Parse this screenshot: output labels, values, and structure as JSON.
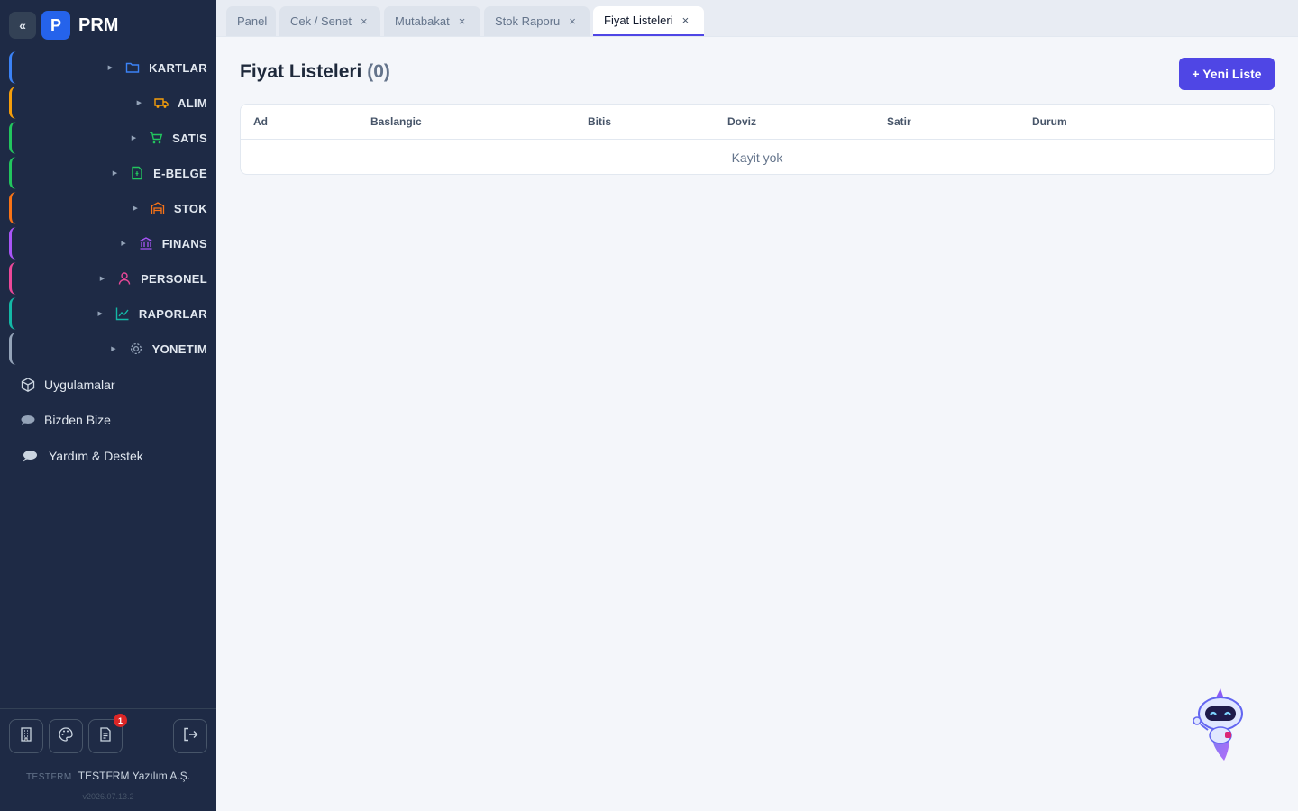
{
  "app": {
    "name": "PRM",
    "logo_letter": "P",
    "collapse_glyph": "«",
    "accent_color": "#4f46e5"
  },
  "sidebar": {
    "groups": [
      {
        "label": "KARTLAR",
        "icon": "folder-icon",
        "color": "#3b82f6"
      },
      {
        "label": "ALIM",
        "icon": "truck-icon",
        "color": "#f59e0b"
      },
      {
        "label": "SATIS",
        "icon": "cart-icon",
        "color": "#22c55e"
      },
      {
        "label": "E-BELGE",
        "icon": "document-icon",
        "color": "#22c55e"
      },
      {
        "label": "STOK",
        "icon": "warehouse-icon",
        "color": "#f97316"
      },
      {
        "label": "FINANS",
        "icon": "bank-icon",
        "color": "#a855f7"
      },
      {
        "label": "PERSONEL",
        "icon": "person-icon",
        "color": "#ec4899"
      },
      {
        "label": "RAPORLAR",
        "icon": "chart-line-icon",
        "color": "#14b8a6"
      },
      {
        "label": "YONETIM",
        "icon": "gear-icon",
        "color": "#94a3b8"
      }
    ],
    "links": [
      {
        "label": "Uygulamalar",
        "icon": "cube-icon"
      },
      {
        "label": "Bizden Bize",
        "icon": "chat-icon"
      },
      {
        "label": "Yardım & Destek",
        "icon": "speech-bubble-icon"
      }
    ],
    "bottom": {
      "notification_count": "1",
      "company_code": "TESTFRM",
      "company_name": "TESTFRM Yazılım A.Ş.",
      "version": "v2026.07.13.2"
    }
  },
  "tabs": [
    {
      "label": "Panel",
      "closable": false
    },
    {
      "label": "Cek / Senet",
      "closable": true
    },
    {
      "label": "Mutabakat",
      "closable": true
    },
    {
      "label": "Stok Raporu",
      "closable": true
    },
    {
      "label": "Fiyat Listeleri",
      "closable": true,
      "active": true
    }
  ],
  "tab_close_glyph": "×",
  "main": {
    "title": "Fiyat Listeleri",
    "count": "(0)",
    "new_button": "+ Yeni Liste",
    "table": {
      "columns": [
        "Ad",
        "Baslangic",
        "Bitis",
        "Doviz",
        "Satir",
        "Durum"
      ],
      "empty_text": "Kayit yok"
    }
  }
}
